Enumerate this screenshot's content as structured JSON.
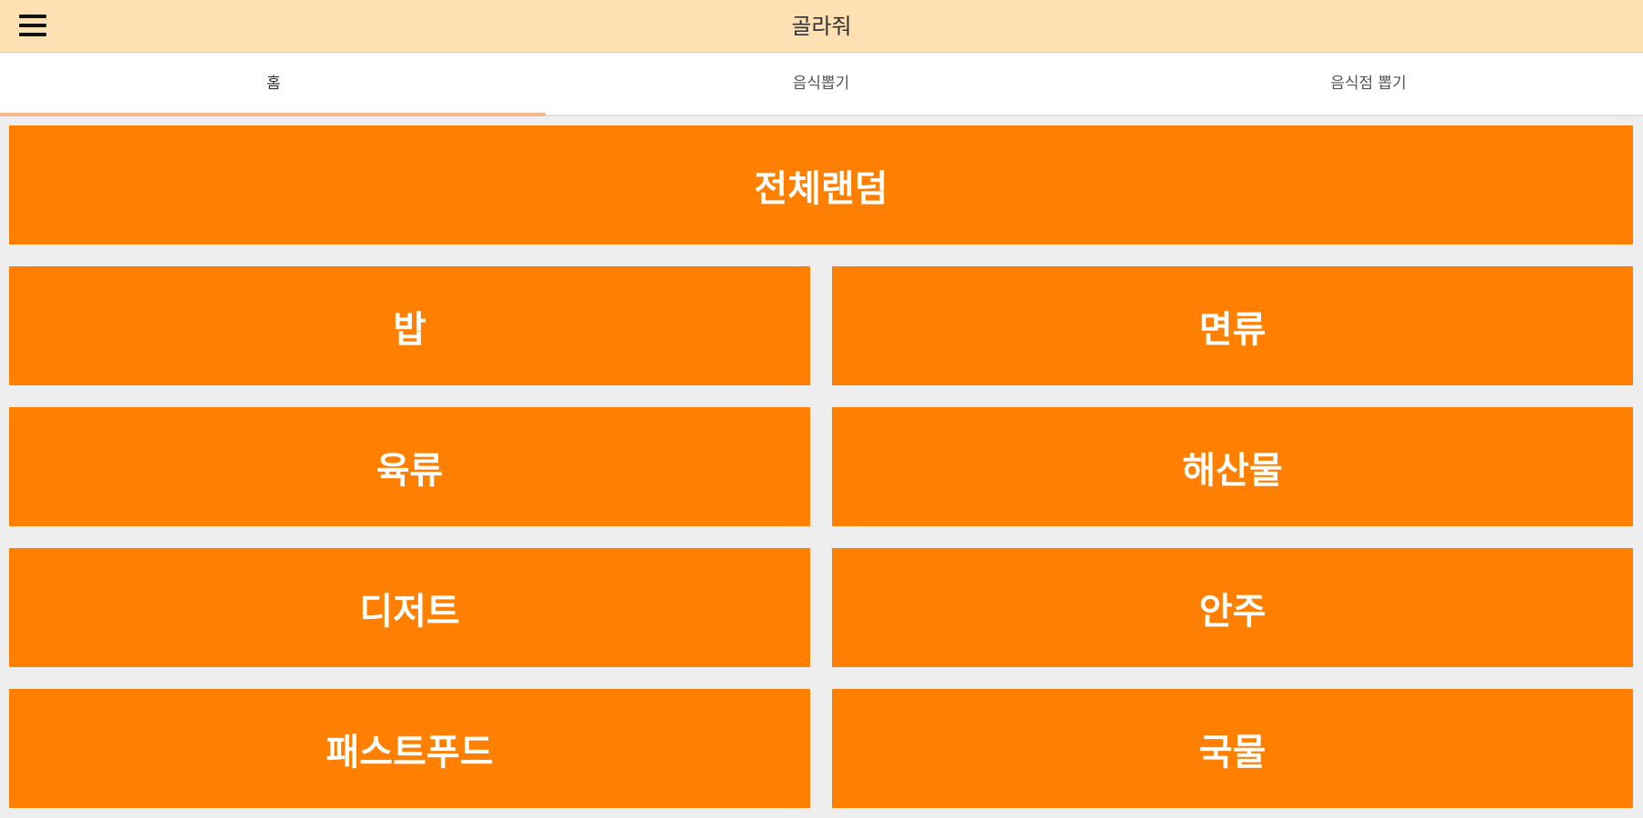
{
  "app": {
    "title": "골라줘",
    "menu_icon": "hamburger-menu-icon"
  },
  "tabs": [
    {
      "label": "홈",
      "active": true
    },
    {
      "label": "음식뽑기",
      "active": false
    },
    {
      "label": "음식점 뽑기",
      "active": false
    }
  ],
  "colors": {
    "appbar": "#ffe0b2",
    "button": "#ff7f00",
    "indicator": "#f4b88a"
  },
  "random_all": {
    "label": "전체랜덤"
  },
  "categories": [
    {
      "label": "밥"
    },
    {
      "label": "면류"
    },
    {
      "label": "육류"
    },
    {
      "label": "해산물"
    },
    {
      "label": "디저트"
    },
    {
      "label": "안주"
    },
    {
      "label": "패스트푸드"
    },
    {
      "label": "국물"
    }
  ]
}
